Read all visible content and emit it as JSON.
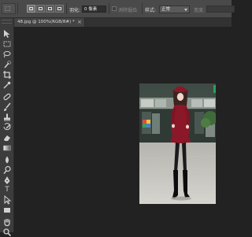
{
  "options_bar": {
    "feather_label": "羽化:",
    "feather_value": "0 像素",
    "antialias_label": "消除锯齿",
    "style_label": "样式:",
    "style_value": "正常",
    "width_label": "宽度:"
  },
  "document_tab": {
    "title": "48.jpg @ 100%(RGB/8#) *",
    "close_icon": "×"
  },
  "toolbar": {
    "tools": [
      "move-tool",
      "marquee-tool",
      "lasso-tool",
      "quick-selection-tool",
      "crop-tool",
      "eyedropper-tool",
      "spot-healing-tool",
      "brush-tool",
      "clone-stamp-tool",
      "history-brush-tool",
      "eraser-tool",
      "gradient-tool",
      "blur-tool",
      "dodge-tool",
      "pen-tool",
      "type-tool",
      "path-selection-tool",
      "rectangle-tool",
      "hand-tool",
      "zoom-tool"
    ],
    "type_glyph": "T"
  },
  "colors": {
    "workspace": "#222222",
    "options_bar": "#4a4a4a",
    "toolbar": "#3c3c3c",
    "dress": "#8a1828"
  }
}
